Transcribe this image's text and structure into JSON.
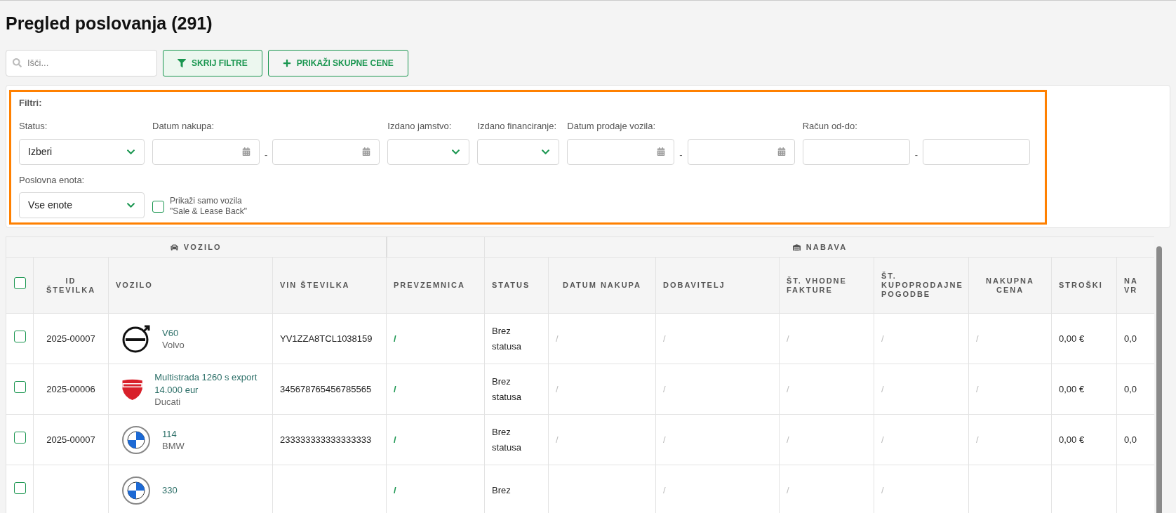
{
  "title": "Pregled poslovanja (291)",
  "search": {
    "placeholder": "Išči..."
  },
  "buttons": [
    {
      "kind": "filter",
      "label": "SKRIJ FILTRE"
    },
    {
      "kind": "plus",
      "label": "PRIKAŽI SKUPNE CENE"
    }
  ],
  "filters": {
    "title": "Filtri:",
    "fields": [
      {
        "kind": "select",
        "label": "Status:",
        "value": "Izberi"
      },
      {
        "kind": "date-range",
        "label": "Datum nakupa:",
        "separator": "-"
      },
      {
        "kind": "select",
        "label": "Izdano jamstvo:"
      },
      {
        "kind": "select",
        "label": "Izdano financiranje:"
      },
      {
        "kind": "date-range",
        "label": "Datum prodaje vozila:",
        "separator": "-"
      },
      {
        "kind": "text-range",
        "label": "Račun od-do:",
        "separator": "-"
      },
      {
        "kind": "select",
        "label": "Poslovna enota:",
        "value": "Vse enote"
      },
      {
        "kind": "checkbox",
        "label": "Prikaži samo vozila\n\"Sale & Lease Back\"",
        "checked": false
      }
    ]
  },
  "table": {
    "groups": [
      {
        "kind": "car",
        "label": "VOZILO"
      },
      {
        "kind": "blank"
      },
      {
        "kind": "garage",
        "label": "NABAVA"
      }
    ],
    "header_checkbox": {
      "checked": false
    },
    "columns": [
      {
        "label": "ID ŠTEVILKA",
        "kind": "center"
      },
      {
        "label": "VOZILO",
        "kind": "vehicle"
      },
      {
        "label": "VIN ŠTEVILKA",
        "kind": "plain"
      },
      {
        "label": "PREVZEMNICA",
        "kind": "link"
      },
      {
        "label": "STATUS",
        "kind": "plain"
      },
      {
        "label": "DATUM NAKUPA",
        "kind": "muted"
      },
      {
        "label": "DOBAVITELJ",
        "kind": "muted"
      },
      {
        "label": "ŠT. VHODNE FAKTURE",
        "kind": "muted"
      },
      {
        "label": "ŠT. KUPOPRODAJNE POGODBE",
        "kind": "muted"
      },
      {
        "label": "NAKUPNA CENA",
        "kind": "muted"
      },
      {
        "label": "STROŠKI",
        "kind": "plain"
      },
      {
        "label": "NA VR",
        "kind": "plain"
      }
    ],
    "rows": [
      {
        "checked": false,
        "cells": [
          "2025-00007",
          {
            "kind": "circle-arrow",
            "model": "V60",
            "make": "Volvo"
          },
          "YV1ZZA8TCL1038159",
          "/",
          "Brez statusa",
          "/",
          "/",
          "/",
          "/",
          "/",
          "0,00 €",
          "0,0"
        ]
      },
      {
        "checked": false,
        "cells": [
          "2025-00006",
          {
            "kind": "shield",
            "model": "Multistrada 1260 s export 14.000 eur",
            "make": "Ducati"
          },
          "345678765456785565",
          "/",
          "Brez statusa",
          "/",
          "/",
          "/",
          "/",
          "/",
          "0,00 €",
          "0,0"
        ]
      },
      {
        "checked": false,
        "cells": [
          "2025-00007",
          {
            "kind": "roundel",
            "model": "114",
            "make": "BMW"
          },
          "233333333333333333",
          "/",
          "Brez statusa",
          "/",
          "/",
          "/",
          "/",
          "/",
          "0,00 €",
          "0,0"
        ]
      },
      {
        "checked": false,
        "cells": [
          null,
          {
            "kind": "roundel",
            "model": "330"
          },
          null,
          "/",
          "Brez",
          null,
          "/",
          "/",
          "/",
          null,
          null,
          null
        ]
      }
    ]
  }
}
